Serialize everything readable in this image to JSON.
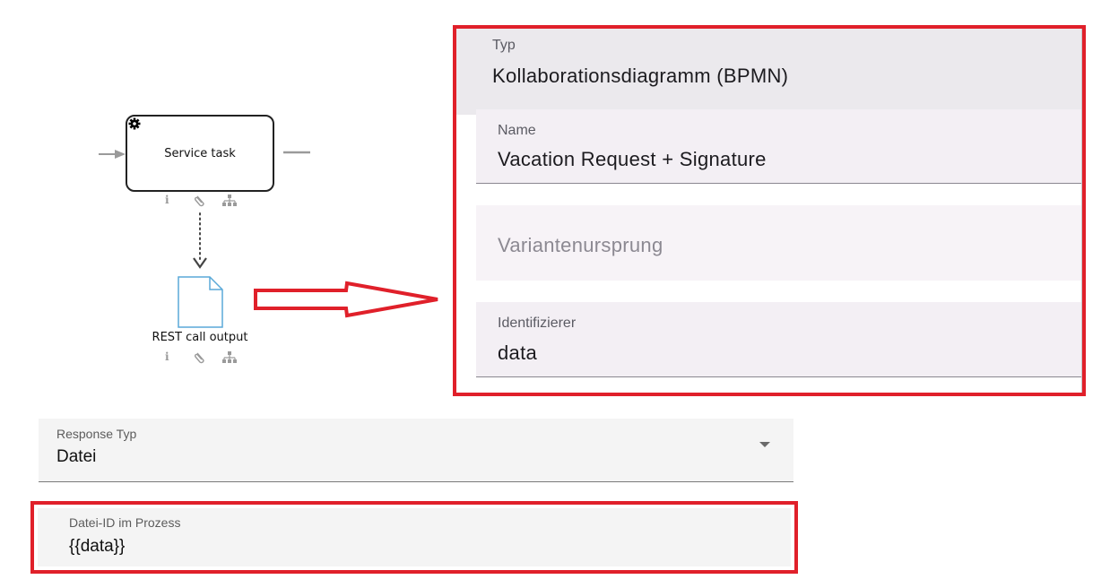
{
  "diagram": {
    "service_task": {
      "label": "Service task",
      "icon": "gear-icon"
    },
    "data_object": {
      "label": "REST call output",
      "icon": "document-icon"
    },
    "hint_icons": [
      "info-icon",
      "paperclip-icon",
      "hierarchy-icon"
    ],
    "info_glyph": "i"
  },
  "properties_panel": {
    "type": {
      "label": "Typ",
      "value": "Kollaborationsdiagramm (BPMN)"
    },
    "name": {
      "label": "Name",
      "value": "Vacation Request + Signature"
    },
    "variant_origin": {
      "placeholder": "Variantenursprung"
    },
    "identifier": {
      "label": "Identifizierer",
      "value": "data"
    }
  },
  "rest_form": {
    "response_type": {
      "label": "Response Typ",
      "value": "Datei"
    },
    "file_id": {
      "label": "Datei-ID im Prozess",
      "value": "{{data}}"
    }
  },
  "colors": {
    "highlight": "#e0202a",
    "field_background": "#f3eff4",
    "doc_border": "#5aa9d8"
  }
}
